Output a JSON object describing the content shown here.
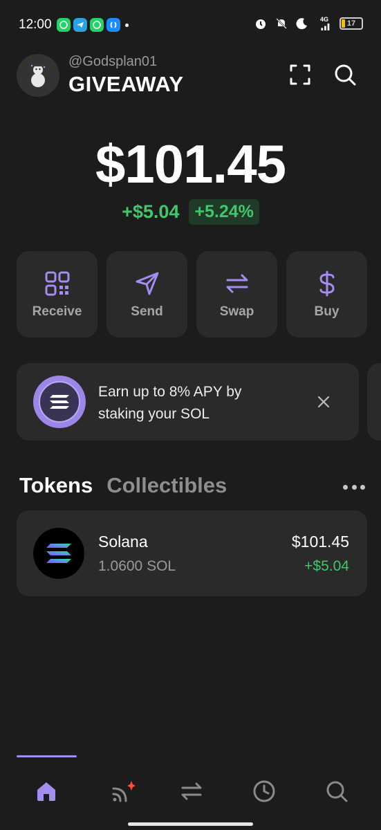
{
  "status_bar": {
    "time": "12:00",
    "apps": [
      "whatsapp-icon",
      "telegram-icon",
      "whatsapp-business-icon",
      "shazam-icon"
    ],
    "network": "4G",
    "battery": "17",
    "battery_color": "#f2c200"
  },
  "header": {
    "handle": "@Godsplan01",
    "account_name": "GIVEAWAY",
    "avatar_icon": "snowman-icon",
    "scan_icon": "scan-icon",
    "search_icon": "search-icon"
  },
  "balance": {
    "total": "$101.45",
    "change_amount": "+$5.04",
    "change_percent": "+5.24%"
  },
  "actions": [
    {
      "label": "Receive",
      "icon": "qr-code-icon"
    },
    {
      "label": "Send",
      "icon": "send-icon"
    },
    {
      "label": "Swap",
      "icon": "swap-icon"
    },
    {
      "label": "Buy",
      "icon": "dollar-icon"
    }
  ],
  "promo": {
    "text": "Earn up to 8% APY by staking your SOL",
    "icon": "solana-icon",
    "close_icon": "close-icon"
  },
  "tabs": {
    "tokens": "Tokens",
    "collectibles": "Collectibles"
  },
  "tokens": [
    {
      "name": "Solana",
      "amount": "1.0600 SOL",
      "value": "$101.45",
      "change": "+$5.04"
    }
  ],
  "nav": [
    "home-icon",
    "explore-icon",
    "swap-icon",
    "history-icon",
    "search-icon"
  ],
  "colors": {
    "accent": "#a48cf0",
    "positive": "#3fc86b",
    "background": "#1c1c1c",
    "card": "#2a2a2a",
    "notification": "#ff4b3a"
  }
}
